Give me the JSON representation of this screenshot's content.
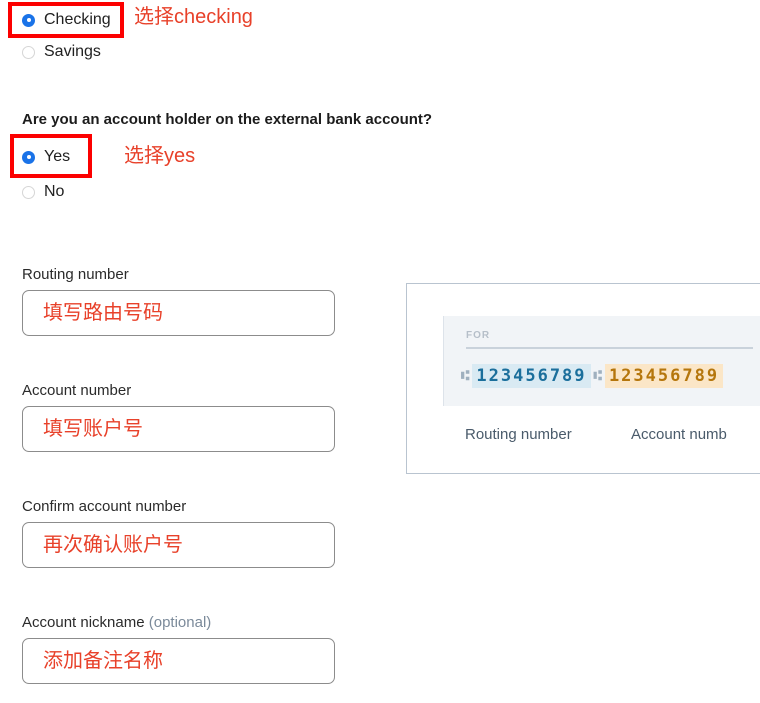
{
  "account_type": {
    "options": [
      {
        "label": "Checking",
        "selected": true
      },
      {
        "label": "Savings",
        "selected": false
      }
    ],
    "annotation": "选择checking"
  },
  "holder_question": {
    "text": "Are you an account holder on the external bank account?",
    "options": [
      {
        "label": "Yes",
        "selected": true
      },
      {
        "label": "No",
        "selected": false
      }
    ],
    "annotation": "选择yes"
  },
  "fields": [
    {
      "label": "Routing number",
      "optional_suffix": "",
      "value": "填写路由号码"
    },
    {
      "label": "Account number",
      "optional_suffix": "",
      "value": "填写账户号"
    },
    {
      "label": "Confirm account number",
      "optional_suffix": "",
      "value": "再次确认账户号"
    },
    {
      "label": "Account nickname",
      "optional_suffix": "(optional)",
      "value": "添加备注名称"
    }
  ],
  "check_illustration": {
    "for_label": "FOR",
    "routing_micr": "123456789",
    "account_micr": "123456789",
    "micr_symbol_left": "⑆",
    "micr_symbol_mid": "⑆",
    "caption_routing": "Routing number",
    "caption_account": "Account numb"
  },
  "colors": {
    "annotation_red": "#e8412a",
    "highlight_box": "#fc0000",
    "radio_selected": "#1a73e8",
    "micr_routing": "#1b6f9c",
    "micr_account": "#b5760c"
  }
}
